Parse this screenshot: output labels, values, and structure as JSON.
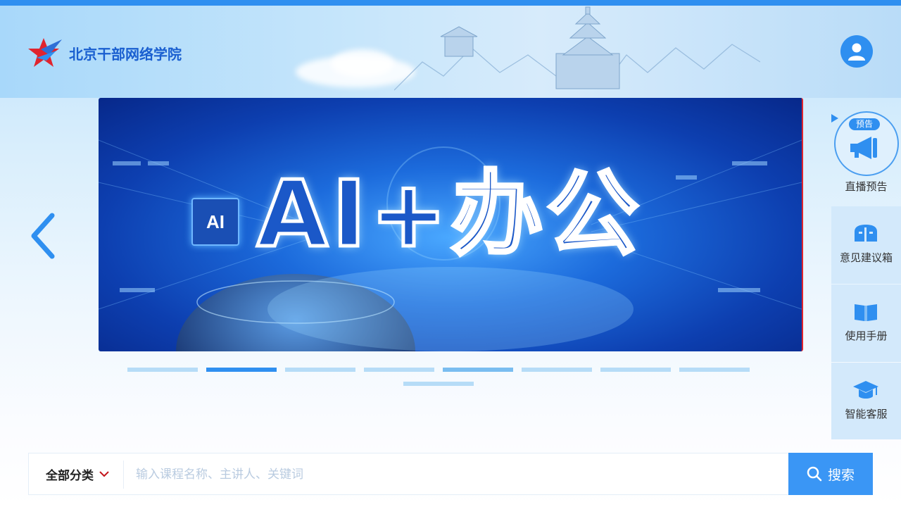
{
  "header": {
    "site_title": "北京干部网络学院"
  },
  "banner": {
    "badge": "AI",
    "title": "AI+办公",
    "slide_count": 9,
    "active_index": 1
  },
  "side": {
    "live_tag": "预告",
    "live_label": "直播预告",
    "items": [
      {
        "label": "意见建议箱",
        "icon": "mailbox-icon"
      },
      {
        "label": "使用手册",
        "icon": "book-icon"
      },
      {
        "label": "智能客服",
        "icon": "graduation-cap-icon"
      }
    ]
  },
  "search": {
    "category_label": "全部分类",
    "placeholder": "输入课程名称、主讲人、关键词",
    "value": "",
    "button_label": "搜索"
  },
  "colors": {
    "primary": "#2f8ff0",
    "accent": "#e0242e"
  }
}
